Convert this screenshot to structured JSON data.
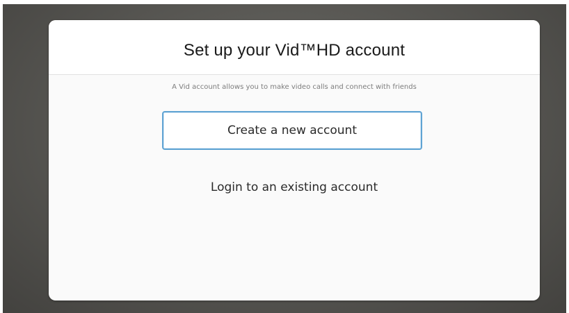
{
  "dialog": {
    "title": "Set up your Vid™HD account",
    "subtitle": "A Vid account allows you to make video calls and connect with friends",
    "primary_button_label": "Create a new account",
    "secondary_link_label": "Login to an existing account"
  },
  "colors": {
    "accent_border": "#5fa3d3",
    "dialog_background": "#fafafa",
    "backdrop": "#55544f"
  }
}
